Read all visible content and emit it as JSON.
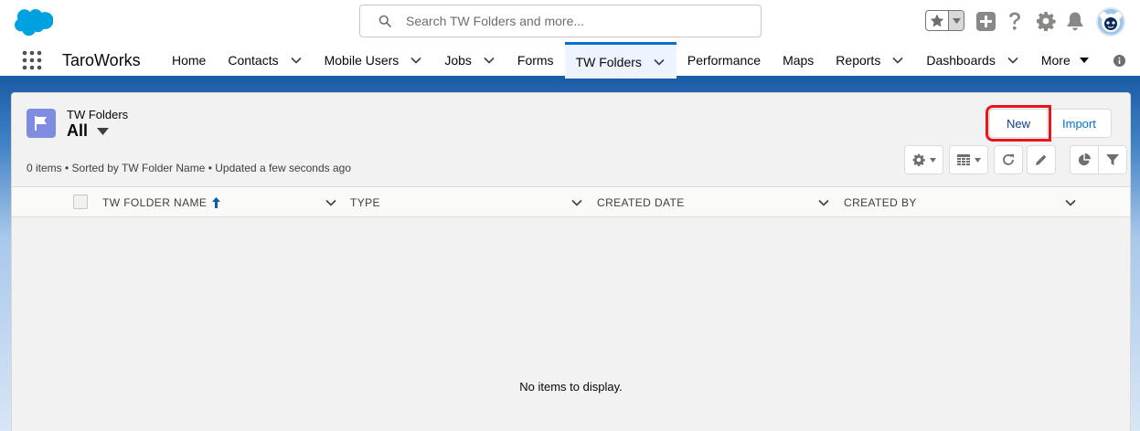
{
  "header": {
    "search_placeholder": "Search TW Folders and more..."
  },
  "nav": {
    "app_name": "TaroWorks",
    "items": [
      {
        "label": "Home",
        "has_menu": false
      },
      {
        "label": "Contacts",
        "has_menu": true
      },
      {
        "label": "Mobile Users",
        "has_menu": true
      },
      {
        "label": "Jobs",
        "has_menu": true
      },
      {
        "label": "Forms",
        "has_menu": false
      },
      {
        "label": "TW Folders",
        "has_menu": true,
        "active": true
      },
      {
        "label": "Performance",
        "has_menu": false
      },
      {
        "label": "Maps",
        "has_menu": false
      },
      {
        "label": "Reports",
        "has_menu": true
      },
      {
        "label": "Dashboards",
        "has_menu": true
      },
      {
        "label": "More",
        "has_menu": true
      }
    ]
  },
  "list_view": {
    "object_label": "TW Folders",
    "view_name": "All",
    "status": "0 items • Sorted by TW Folder Name • Updated a few seconds ago",
    "buttons": {
      "new_label": "New",
      "import_label": "Import"
    },
    "columns": [
      {
        "label": "TW FOLDER NAME",
        "sorted": true
      },
      {
        "label": "TYPE",
        "sorted": false
      },
      {
        "label": "CREATED DATE",
        "sorted": false
      },
      {
        "label": "CREATED BY",
        "sorted": false
      }
    ],
    "empty_message": "No items to display."
  },
  "colors": {
    "brand_blue": "#0070d2",
    "object_icon": "#7f8de1",
    "highlight_red": "#e8161b"
  }
}
